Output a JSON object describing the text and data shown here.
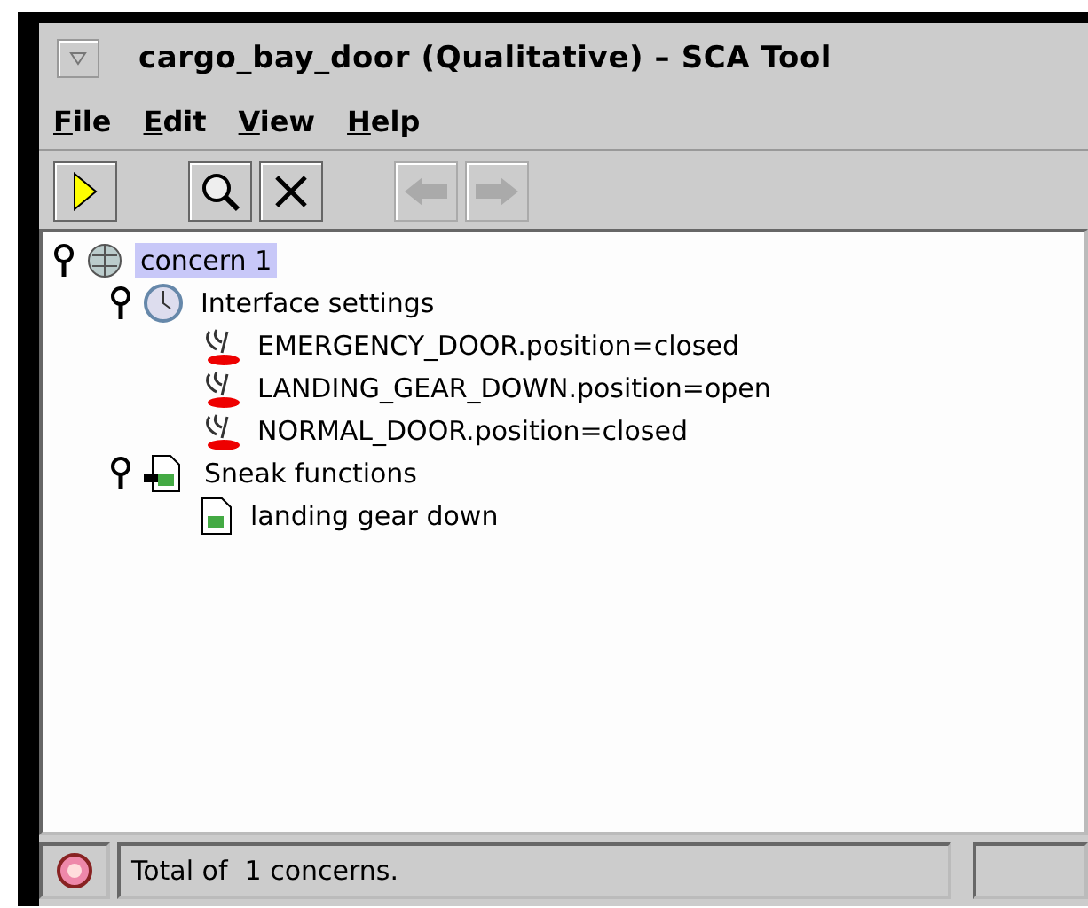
{
  "window": {
    "title": "cargo_bay_door (Qualitative)  – SCA Tool"
  },
  "menu": [
    {
      "mnemonic": "F",
      "rest": "ile"
    },
    {
      "mnemonic": "E",
      "rest": "dit"
    },
    {
      "mnemonic": "V",
      "rest": "iew"
    },
    {
      "mnemonic": "H",
      "rest": "elp"
    }
  ],
  "toolbar": [
    {
      "kind": "run",
      "disabled": false
    },
    {
      "kind": "search",
      "disabled": false
    },
    {
      "kind": "close",
      "disabled": false
    },
    {
      "kind": "back",
      "disabled": true
    },
    {
      "kind": "forward",
      "disabled": true
    }
  ],
  "tree": [
    {
      "label": "concern 1",
      "kind": "concern",
      "expanded": true,
      "selected": true,
      "children": [
        {
          "label": "Interface settings",
          "kind": "clock",
          "expanded": true,
          "selected": false,
          "children": [
            {
              "label": "EMERGENCY_DOOR.position=closed",
              "kind": "setting",
              "selected": false
            },
            {
              "label": "LANDING_GEAR_DOWN.position=open",
              "kind": "setting",
              "selected": false
            },
            {
              "label": "NORMAL_DOOR.position=closed",
              "kind": "setting",
              "selected": false
            }
          ]
        },
        {
          "label": "Sneak functions",
          "kind": "functions",
          "expanded": true,
          "selected": false,
          "children": [
            {
              "label": "landing gear down",
              "kind": "function",
              "selected": false
            }
          ]
        }
      ]
    }
  ],
  "status_bar": {
    "text": "Total of  1 concerns."
  }
}
